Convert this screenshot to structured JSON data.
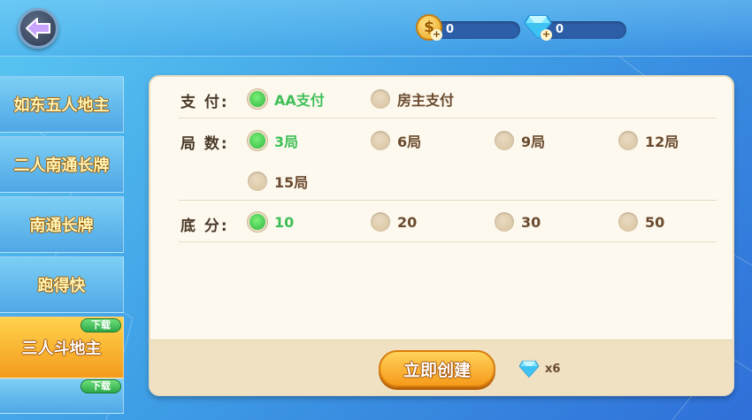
{
  "topbar": {
    "coins": {
      "icon": "coin-icon",
      "value": "0",
      "plus": "+"
    },
    "diamonds": {
      "icon": "diamond-icon",
      "value": "0",
      "plus": "+"
    }
  },
  "sidebar": {
    "items": [
      {
        "label": "如东五人地主",
        "active": false
      },
      {
        "label": "二人南通长牌",
        "active": false
      },
      {
        "label": "南通长牌",
        "active": false
      },
      {
        "label": "跑得快",
        "active": false
      },
      {
        "label": "三人斗地主",
        "active": true
      }
    ],
    "download_label": "下载"
  },
  "panel": {
    "payment": {
      "label": "支 付:",
      "options": [
        "AA支付",
        "房主支付"
      ],
      "selected": "AA支付"
    },
    "rounds": {
      "label": "局 数:",
      "options": [
        "3局",
        "6局",
        "9局",
        "12局",
        "15局"
      ],
      "selected": "3局"
    },
    "base_score": {
      "label": "底 分:",
      "options": [
        "10",
        "20",
        "30",
        "50"
      ],
      "selected": "10"
    },
    "create_label": "立即创建",
    "cost": {
      "icon": "diamond-icon",
      "value": "x6"
    }
  },
  "colors": {
    "selected": "#3fbf57",
    "accent": "#f59a1a",
    "panel": "#fdf9ee"
  }
}
